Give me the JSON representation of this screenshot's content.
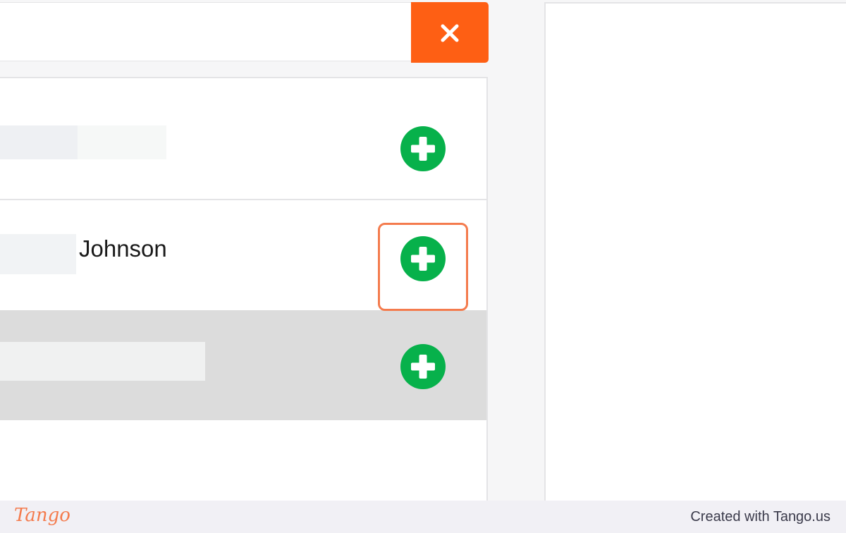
{
  "dialog": {
    "close_icon": "close-icon",
    "close_color": "#fe5f14"
  },
  "list": {
    "rows": [
      {
        "name": "",
        "action_icon": "plus-circle-icon"
      },
      {
        "name": "Johnson",
        "action_icon": "plus-circle-icon",
        "highlighted": true
      },
      {
        "name": "",
        "action_icon": "plus-circle-icon",
        "selected": true
      }
    ],
    "add_color": "#07b14b",
    "highlight_color": "#f47b4d"
  },
  "footer": {
    "logo_text": "Tango",
    "credit_text": "Created with Tango.us"
  }
}
